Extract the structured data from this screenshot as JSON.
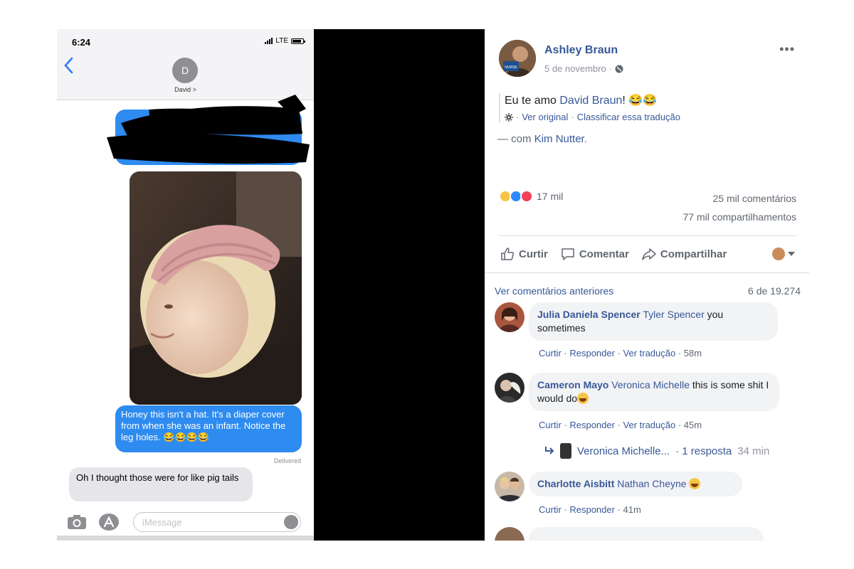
{
  "phone": {
    "status_time": "6:24",
    "network": "LTE",
    "contact_initial": "D",
    "contact_name": "David >",
    "messages": [
      {
        "from": "me",
        "text": "Honey this isn't a hat. It's a diaper cover from when she was an infant. Notice the leg holes. 😂😂😂😂"
      },
      {
        "from": "them",
        "text": "Oh I thought those were for like pig tails"
      }
    ],
    "delivered_label": "Delivered",
    "compose_placeholder": "iMessage"
  },
  "facebook": {
    "author": "Ashley Braun",
    "date": "5 de novembro ·",
    "post_text_prefix": "Eu te amo ",
    "post_tag": "David Braun",
    "post_text_suffix": "! 😂😂",
    "see_original": "Ver original",
    "rate_translation": "Classificar essa tradução",
    "with_prefix": "— com ",
    "with_name": "Kim Nutter",
    "with_suffix": ".",
    "reaction_count": "17 mil",
    "comment_count": "25 mil comentários",
    "share_count": "77 mil compartilhamentos",
    "actions": {
      "like": "Curtir",
      "comment": "Comentar",
      "share": "Compartilhar"
    },
    "view_previous": "Ver comentários anteriores",
    "comment_position": "6 de 19.274",
    "comments": [
      {
        "name": "Julia Daniela Spencer",
        "tag": "Tyler Spencer",
        "text": " you sometimes",
        "meta_like": "Curtir",
        "meta_reply": "Responder",
        "meta_translate": "Ver tradução",
        "time": "58m"
      },
      {
        "name": "Cameron Mayo",
        "tag": "Veronica Michelle",
        "text": " this is some shit I would do",
        "meta_like": "Curtir",
        "meta_reply": "Responder",
        "meta_translate": "Ver tradução",
        "time": "45m"
      },
      {
        "name": "Charlotte Aisbitt",
        "tag": "Nathan Cheyne",
        "text": "",
        "meta_like": "Curtir",
        "meta_reply": "Responder",
        "time": "41m"
      }
    ],
    "reply": {
      "name": "Veronica Michelle...",
      "count": "· 1 resposta",
      "time": "34 min"
    }
  },
  "colors": {
    "imessage_blue": "#2e8bf0",
    "fb_link": "#365899",
    "fb_gray": "#606770"
  }
}
